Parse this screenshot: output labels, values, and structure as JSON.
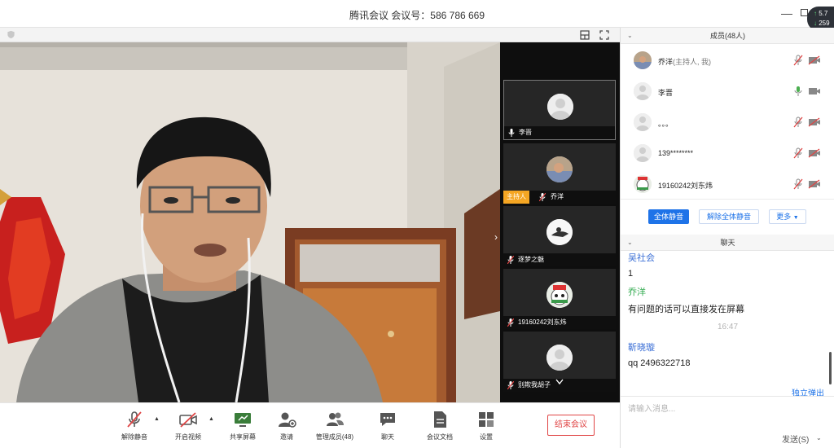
{
  "window": {
    "title": "腾讯会议 会议号：586 786 669",
    "net_up": "5.7",
    "net_down": "259"
  },
  "participants_thumbs": [
    {
      "name": "李晋",
      "mic": "on",
      "host": false
    },
    {
      "name": "乔洋",
      "mic": "muted",
      "host": true
    },
    {
      "name": "逐梦之魅",
      "mic": "muted",
      "host": false
    },
    {
      "name": "19160242刘东炜",
      "mic": "muted",
      "host": false
    },
    {
      "name": "别欺我胡子",
      "mic": "muted",
      "host": false
    }
  ],
  "host_tag": "主持人",
  "toolbar": {
    "unmute": "解除静音",
    "start_video": "开启视频",
    "share_screen": "共享屏幕",
    "invite": "邀请",
    "manage_members": "管理成员(48)",
    "chat": "聊天",
    "docs": "会议文档",
    "settings": "设置",
    "end_meeting": "结束会议"
  },
  "members": {
    "header": "成员(48人)",
    "list": [
      {
        "name": "乔洋",
        "suffix": "(主持人, 我)",
        "mic": "muted",
        "cam": "off"
      },
      {
        "name": "李晋",
        "suffix": "",
        "mic": "on",
        "cam": "on"
      },
      {
        "name": "。。。",
        "suffix": "",
        "mic": "muted",
        "cam": "off"
      },
      {
        "name": "139********",
        "suffix": "",
        "mic": "muted",
        "cam": "off"
      },
      {
        "name": "19160242刘东炜",
        "suffix": "",
        "mic": "muted",
        "cam": "off"
      }
    ],
    "mute_all": "全体静音",
    "unmute_all": "解除全体静音",
    "more": "更多"
  },
  "chat": {
    "header": "聊天",
    "messages": [
      {
        "type": "name",
        "text": "吴社会",
        "color": "blue"
      },
      {
        "type": "text",
        "text": "1"
      },
      {
        "type": "name",
        "text": "乔洋",
        "color": "green"
      },
      {
        "type": "text",
        "text": "有问题的话可以直接发在屏幕"
      },
      {
        "type": "time",
        "text": "16:47"
      },
      {
        "type": "name",
        "text": "靳晓璇",
        "color": "blue"
      },
      {
        "type": "text",
        "text": "qq 2496322718"
      }
    ],
    "popout": "独立弹出",
    "placeholder": "请输入消息...",
    "send": "发送(S)"
  },
  "colors": {
    "accent": "#1e73e8",
    "end_red": "#e04545",
    "host_orange": "#f5a623",
    "muted_red": "#e04545"
  }
}
